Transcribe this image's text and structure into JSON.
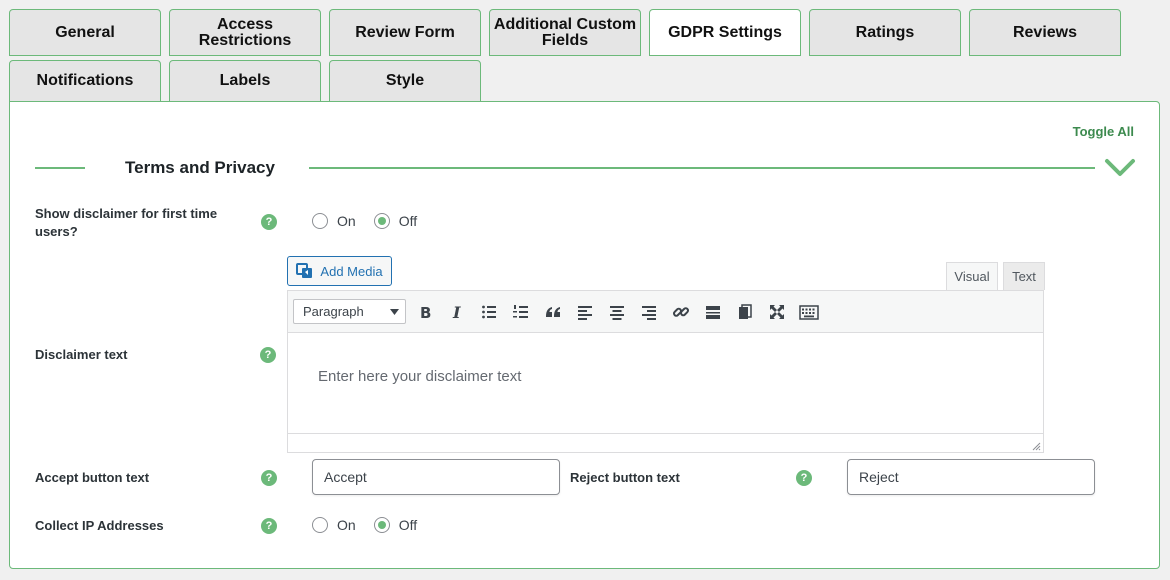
{
  "tabs": {
    "general": "General",
    "access_restrictions": "Access Restrictions",
    "review_form": "Review Form",
    "additional_custom_fields": "Additional Custom Fields",
    "gdpr_settings": "GDPR Settings",
    "ratings": "Ratings",
    "reviews": "Reviews",
    "notifications": "Notifications",
    "labels": "Labels",
    "style": "Style",
    "active": "GDPR Settings"
  },
  "panel": {
    "toggle_all": "Toggle All",
    "section_title": "Terms and Privacy",
    "help_glyph": "?"
  },
  "fields": {
    "show_disclaimer": {
      "label": "Show disclaimer for first time users?",
      "option_on": "On",
      "option_off": "Off",
      "selected": "Off"
    },
    "disclaimer_text": {
      "label": "Disclaimer text",
      "add_media": "Add Media",
      "tab_visual": "Visual",
      "tab_text": "Text",
      "format_select": "Paragraph",
      "placeholder": "Enter here your disclaimer text",
      "toolbar_icons": [
        "bold-icon",
        "italic-icon",
        "bullet-list-icon",
        "numbered-list-icon",
        "blockquote-icon",
        "align-left-icon",
        "align-center-icon",
        "align-right-icon",
        "link-icon",
        "read-more-icon",
        "paste-icon",
        "fullscreen-icon",
        "keyboard-icon"
      ]
    },
    "accept_button_text": {
      "label": "Accept button text",
      "value": "Accept"
    },
    "reject_button_text": {
      "label": "Reject button text",
      "value": "Reject"
    },
    "collect_ip": {
      "label": "Collect IP Addresses",
      "option_on": "On",
      "option_off": "Off",
      "selected": "Off"
    }
  },
  "colors": {
    "accent_green": "#6cb97a",
    "toggle_all_green": "#3c8a4e",
    "link_blue": "#2271b1",
    "tab_bg": "#e5e5e5",
    "page_bg": "#f0f0f0"
  }
}
